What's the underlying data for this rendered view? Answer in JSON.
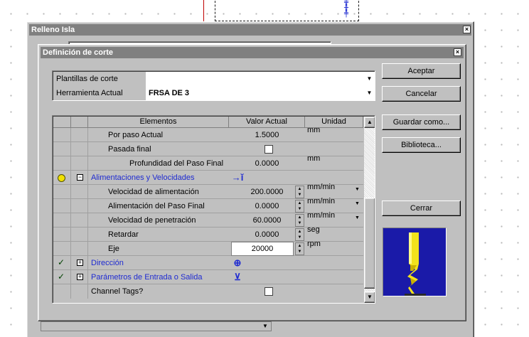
{
  "outer_dialog": {
    "title": "Relleno Isla"
  },
  "inner_dialog": {
    "title": "Definición de corte"
  },
  "combos": [
    {
      "label": "Plantillas de corte",
      "value": ""
    },
    {
      "label": "Herramienta Actual",
      "value": "FRSA DE 3"
    }
  ],
  "buttons": {
    "accept": "Aceptar",
    "cancel": "Cancelar",
    "save_as": "Guardar como...",
    "library": "Biblioteca...",
    "close": "Cerrar"
  },
  "grid": {
    "headers": [
      "Elementos",
      "Valor Actual",
      "Unidad"
    ],
    "rows": [
      {
        "name": "Por paso Actual",
        "value": "1.5000",
        "unit": "mm"
      },
      {
        "name": "Pasada final",
        "value": "",
        "unit": ""
      },
      {
        "name": "Profundidad del Paso Final",
        "value": "0.0000",
        "unit": "mm"
      },
      {
        "name": "Alimentaciones y Velocidades",
        "value": "",
        "unit": ""
      },
      {
        "name": "Velocidad de alimentación",
        "value": "200.0000",
        "unit": "mm/min"
      },
      {
        "name": "Alimentación del Paso Final",
        "value": "0.0000",
        "unit": "mm/min"
      },
      {
        "name": "Velocidad de penetración",
        "value": "60.0000",
        "unit": "mm/min"
      },
      {
        "name": "Retardar",
        "value": "0.0000",
        "unit": "seg"
      },
      {
        "name": "Eje",
        "value": "20000",
        "unit": "rpm"
      },
      {
        "name": "Dirección",
        "value": "",
        "unit": ""
      },
      {
        "name": "Parámetros de Entrada o Salida",
        "value": "",
        "unit": ""
      },
      {
        "name": "Channel Tags?",
        "value": "",
        "unit": ""
      }
    ]
  },
  "colors": {
    "dialog_face": "#c0c0c0",
    "group_text": "#1f2bd1",
    "preview_background": "#1a1aa8",
    "tool_yellow": "#f2e21c"
  },
  "icons": {
    "feeds_group": "feed-speed-icon",
    "direction_group": "direction-icon",
    "entry_exit_group": "entry-exit-icon",
    "preview": "drill-bit-preview"
  }
}
